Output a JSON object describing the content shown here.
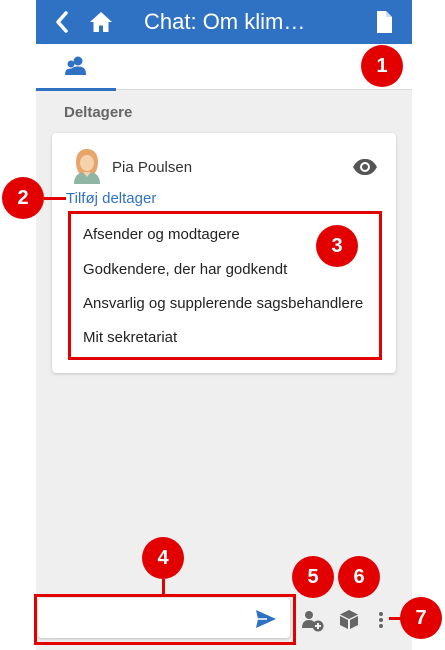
{
  "header": {
    "title": "Chat: Om klim…",
    "back_icon": "chevron-left-icon",
    "home_icon": "home-icon",
    "document_icon": "document-icon"
  },
  "tabs": [
    {
      "icon": "participants-icon",
      "active": true
    }
  ],
  "participants_section": {
    "title": "Deltagere",
    "participant": {
      "name": "Pia Poulsen",
      "avatar_icon": "person-avatar-icon",
      "view_icon": "eye-icon"
    },
    "add_link": "Tilføj deltager",
    "menu_items": [
      "Afsender og modtagere",
      "Godkendere, der har godkendt",
      "Ansvarlig og supplerende sagsbehandlere",
      "Mit sekretariat"
    ]
  },
  "composer": {
    "value": "",
    "placeholder": "",
    "send_icon": "send-icon",
    "add_participant_icon": "add-participant-icon",
    "package_icon": "package-icon",
    "more_icon": "more-vertical-icon"
  },
  "annotations": [
    "1",
    "2",
    "3",
    "4",
    "5",
    "6",
    "7"
  ],
  "colors": {
    "primary": "#2f72c4",
    "annotation": "#e20000",
    "background": "#efefef"
  }
}
